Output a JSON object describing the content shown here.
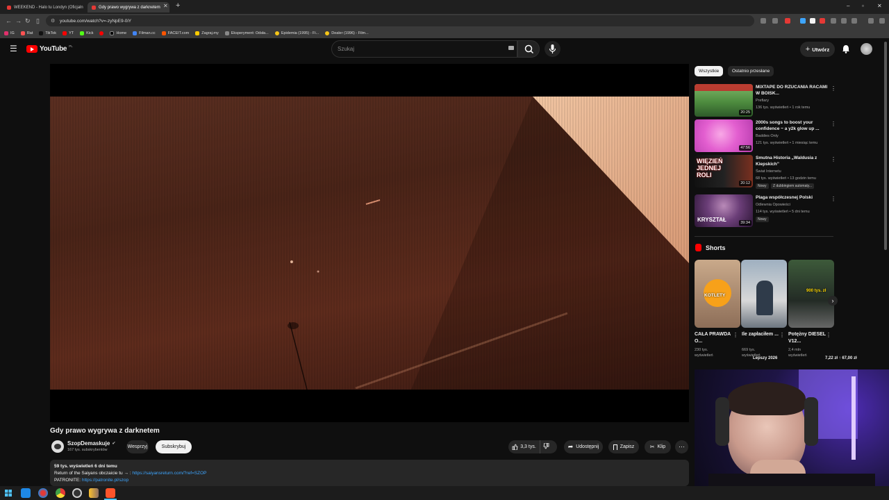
{
  "browser": {
    "tabs": [
      {
        "label": "WEEKEND - Halo tu Londyn (Oficjaln"
      },
      {
        "label": "Gdy prawo wygrywa z darknetem"
      }
    ],
    "url": "youtube.com/watch?v=-zyNpE9-0iY",
    "bookmarks": [
      {
        "label": "IG",
        "color": "#e1306c"
      },
      {
        "label": "Rat",
        "color": "#ff5252"
      },
      {
        "label": "TikTok",
        "color": "#222222"
      },
      {
        "label": "YT",
        "color": "#ff0000"
      },
      {
        "label": "Kick",
        "color": "#53fc18"
      },
      {
        "label": "",
        "color": "#ff0000"
      },
      {
        "label": "Home",
        "color": "#000000"
      },
      {
        "label": "Filman.cc",
        "color": "#4285f4"
      },
      {
        "label": "FACEIT.com",
        "color": "#ff5500"
      },
      {
        "label": "Zagraj.my",
        "color": "#ffcc00"
      },
      {
        "label": "Eksperyment: Odsła...",
        "color": "#888888"
      },
      {
        "label": "Epidemia (1995) - Fi...",
        "color": "#f5c518"
      },
      {
        "label": "Dealer (1996) - Film...",
        "color": "#f5c518"
      }
    ]
  },
  "header": {
    "logo": "YouTube",
    "region": "PL",
    "search_placeholder": "Szukaj",
    "create_label": "Utwórz"
  },
  "video": {
    "title": "Gdy prawo wygrywa z darknetem",
    "channel": "SzopDemaskuje",
    "subscribers": "167 tys. subskrybentów",
    "support_label": "Wesprzyj",
    "subscribe_label": "Subskrybuj",
    "likes": "3,3 tys.",
    "share_label": "Udostępnij",
    "save_label": "Zapisz",
    "clip_label": "Klip",
    "description": {
      "stats": "59 tys. wyświetleń  6 dni temu",
      "line1_text": "Return of the Saiyans obczaicie tu → :",
      "line1_link": "https://saiyansreturn.com/?ref=SZOP",
      "line2_text": "PATRONITE:",
      "line2_link": "https://patronite.pl/szop"
    }
  },
  "sidebar": {
    "chips": [
      {
        "label": "Wszystkie"
      },
      {
        "label": "Ostatnio przesłane"
      }
    ],
    "recommendations": [
      {
        "title": "MIXTAPE DO RZUCANIA RACAMI W BOISK...",
        "channel": "Prefiary",
        "meta": "136 tys. wyświetleń • 1 rok temu",
        "duration": "20:25",
        "badge": ""
      },
      {
        "title": "2000s songs to boost your confidence ~ a y2k glow up ...",
        "channel": "Baddies Only",
        "meta": "121 tys. wyświetleń • 1 miesiąc temu",
        "duration": "47:56",
        "badge": ""
      },
      {
        "title": "Smutna Historia „Waldusia z Kiepskich”",
        "channel": "Świat Internetu",
        "meta": "68 tys. wyświetleń • 13 godzin temu",
        "duration": "20:12",
        "badge": "Nowy",
        "badge2": "Z dubbingiem automaty..."
      },
      {
        "title": "Plaga współczesnej Polski",
        "channel": "Odlewnia Opowieści",
        "meta": "114 tys. wyświetleń • 5 dni temu",
        "duration": "39:34",
        "badge": "Nowy"
      }
    ],
    "thumb_texts": [
      "KRYSZTAŁ",
      "WIĘZIEŃ JEDNEJ ROLI"
    ],
    "shorts_label": "Shorts",
    "shorts": [
      {
        "title": "CAŁA PRAWDA O...",
        "views": "230 tys. wyświetleń",
        "overlay": "KOTLETY"
      },
      {
        "title": "Ile zapłaciłem ...",
        "views": "669 tys. wyświetleń",
        "overlay": ""
      },
      {
        "title": "Potężny DIESEL V12...",
        "views": "2,4 mln wyświetleń",
        "overlay": "900 tys. zł"
      }
    ],
    "ad_overlay_left": "Lepszy 2026",
    "ad_overlay_right": "7,22 zł ↑ 67,00 zł"
  },
  "colors": {
    "youtube_red": "#ff0000",
    "link": "#3ea6ff",
    "background": "#0f0f0f"
  }
}
